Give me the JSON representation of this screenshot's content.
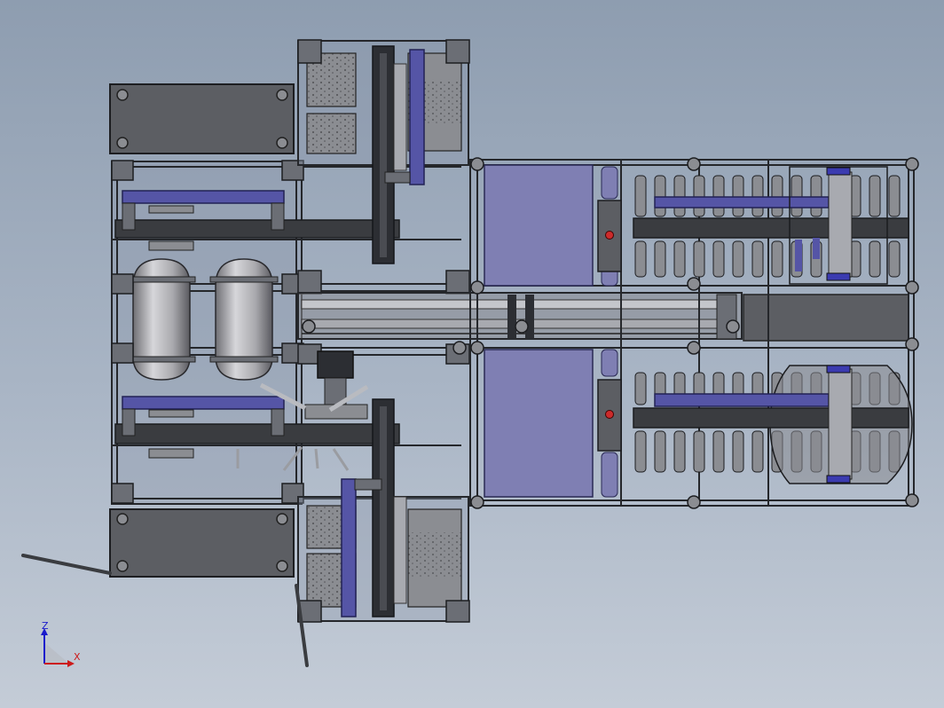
{
  "view": {
    "background_top": "#8e9db0",
    "background_bottom": "#c4ccd7"
  },
  "colors": {
    "frame_dark": "#2c2e33",
    "frame_mid": "#6b6e75",
    "panel_gray": "#5c5e63",
    "plate_light": "#8b8d92",
    "accent_blue": "#5555a6",
    "accent_purple": "#7f7fb3",
    "tank_silver": "#b0b0b5",
    "red_marker": "#cc2b2b"
  },
  "triad": {
    "z_label": "Z",
    "x_label": "X",
    "z_color": "#1a1acc",
    "x_color": "#cc1a1a"
  }
}
